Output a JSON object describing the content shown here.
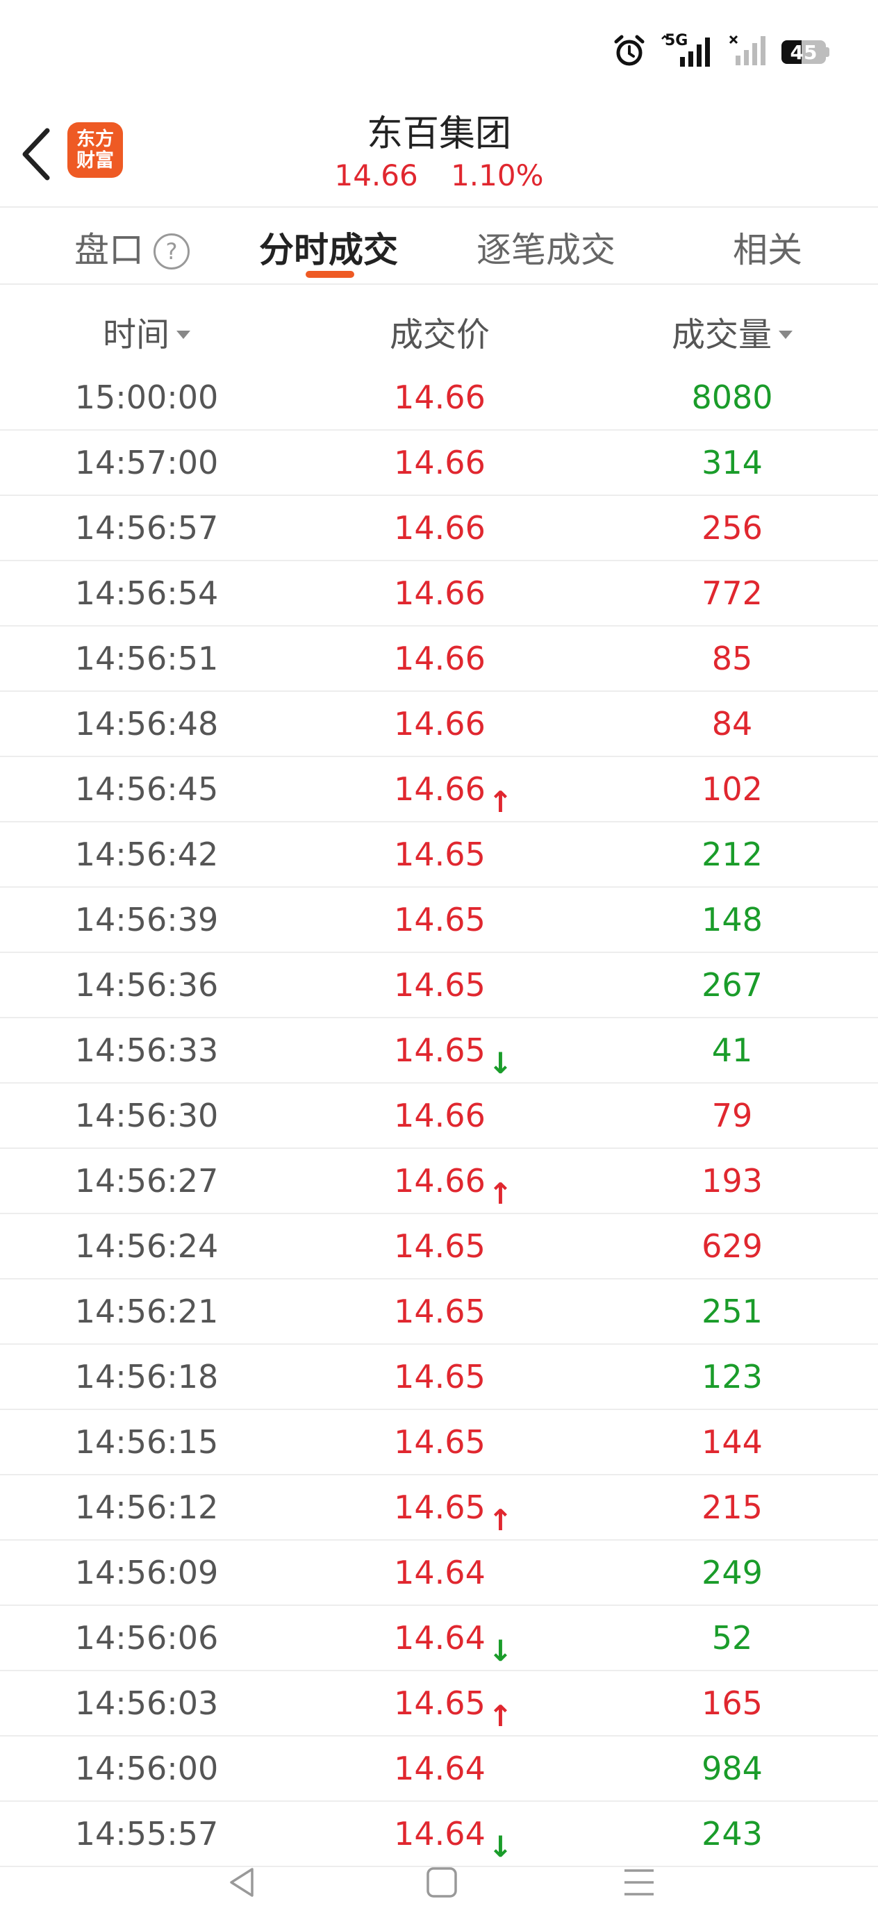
{
  "status_bar": {
    "network_label": "5G",
    "battery_level": "45",
    "battery_fraction": 0.45
  },
  "header": {
    "logo_line1": "东方",
    "logo_line2": "财富",
    "title": "东百集团",
    "price": "14.66",
    "change_pct": "1.10%"
  },
  "tabs": [
    {
      "label": "盘口",
      "help": "?"
    },
    {
      "label": "分时成交",
      "active": true
    },
    {
      "label": "逐笔成交"
    },
    {
      "label": "相关"
    }
  ],
  "columns": {
    "time": "时间",
    "price": "成交价",
    "volume": "成交量"
  },
  "colors": {
    "up": "#e0272f",
    "down": "#1a9c2a",
    "accent": "#ee5a24"
  },
  "rows": [
    {
      "time": "15:00:00",
      "price": "14.66",
      "arrow": "",
      "volume": "8080",
      "vol_color": "green"
    },
    {
      "time": "14:57:00",
      "price": "14.66",
      "arrow": "",
      "volume": "314",
      "vol_color": "green"
    },
    {
      "time": "14:56:57",
      "price": "14.66",
      "arrow": "",
      "volume": "256",
      "vol_color": "red"
    },
    {
      "time": "14:56:54",
      "price": "14.66",
      "arrow": "",
      "volume": "772",
      "vol_color": "red"
    },
    {
      "time": "14:56:51",
      "price": "14.66",
      "arrow": "",
      "volume": "85",
      "vol_color": "red"
    },
    {
      "time": "14:56:48",
      "price": "14.66",
      "arrow": "",
      "volume": "84",
      "vol_color": "red"
    },
    {
      "time": "14:56:45",
      "price": "14.66",
      "arrow": "up",
      "volume": "102",
      "vol_color": "red"
    },
    {
      "time": "14:56:42",
      "price": "14.65",
      "arrow": "",
      "volume": "212",
      "vol_color": "green"
    },
    {
      "time": "14:56:39",
      "price": "14.65",
      "arrow": "",
      "volume": "148",
      "vol_color": "green"
    },
    {
      "time": "14:56:36",
      "price": "14.65",
      "arrow": "",
      "volume": "267",
      "vol_color": "green"
    },
    {
      "time": "14:56:33",
      "price": "14.65",
      "arrow": "down",
      "volume": "41",
      "vol_color": "green"
    },
    {
      "time": "14:56:30",
      "price": "14.66",
      "arrow": "",
      "volume": "79",
      "vol_color": "red"
    },
    {
      "time": "14:56:27",
      "price": "14.66",
      "arrow": "up",
      "volume": "193",
      "vol_color": "red"
    },
    {
      "time": "14:56:24",
      "price": "14.65",
      "arrow": "",
      "volume": "629",
      "vol_color": "red"
    },
    {
      "time": "14:56:21",
      "price": "14.65",
      "arrow": "",
      "volume": "251",
      "vol_color": "green"
    },
    {
      "time": "14:56:18",
      "price": "14.65",
      "arrow": "",
      "volume": "123",
      "vol_color": "green"
    },
    {
      "time": "14:56:15",
      "price": "14.65",
      "arrow": "",
      "volume": "144",
      "vol_color": "red"
    },
    {
      "time": "14:56:12",
      "price": "14.65",
      "arrow": "up",
      "volume": "215",
      "vol_color": "red"
    },
    {
      "time": "14:56:09",
      "price": "14.64",
      "arrow": "",
      "volume": "249",
      "vol_color": "green"
    },
    {
      "time": "14:56:06",
      "price": "14.64",
      "arrow": "down",
      "volume": "52",
      "vol_color": "green"
    },
    {
      "time": "14:56:03",
      "price": "14.65",
      "arrow": "up",
      "volume": "165",
      "vol_color": "red"
    },
    {
      "time": "14:56:00",
      "price": "14.64",
      "arrow": "",
      "volume": "984",
      "vol_color": "green"
    },
    {
      "time": "14:55:57",
      "price": "14.64",
      "arrow": "down",
      "volume": "243",
      "vol_color": "green"
    }
  ],
  "nav": {
    "back_icon": "triangle-back-icon",
    "home_icon": "square-home-icon",
    "menu_icon": "three-lines-menu-icon"
  }
}
